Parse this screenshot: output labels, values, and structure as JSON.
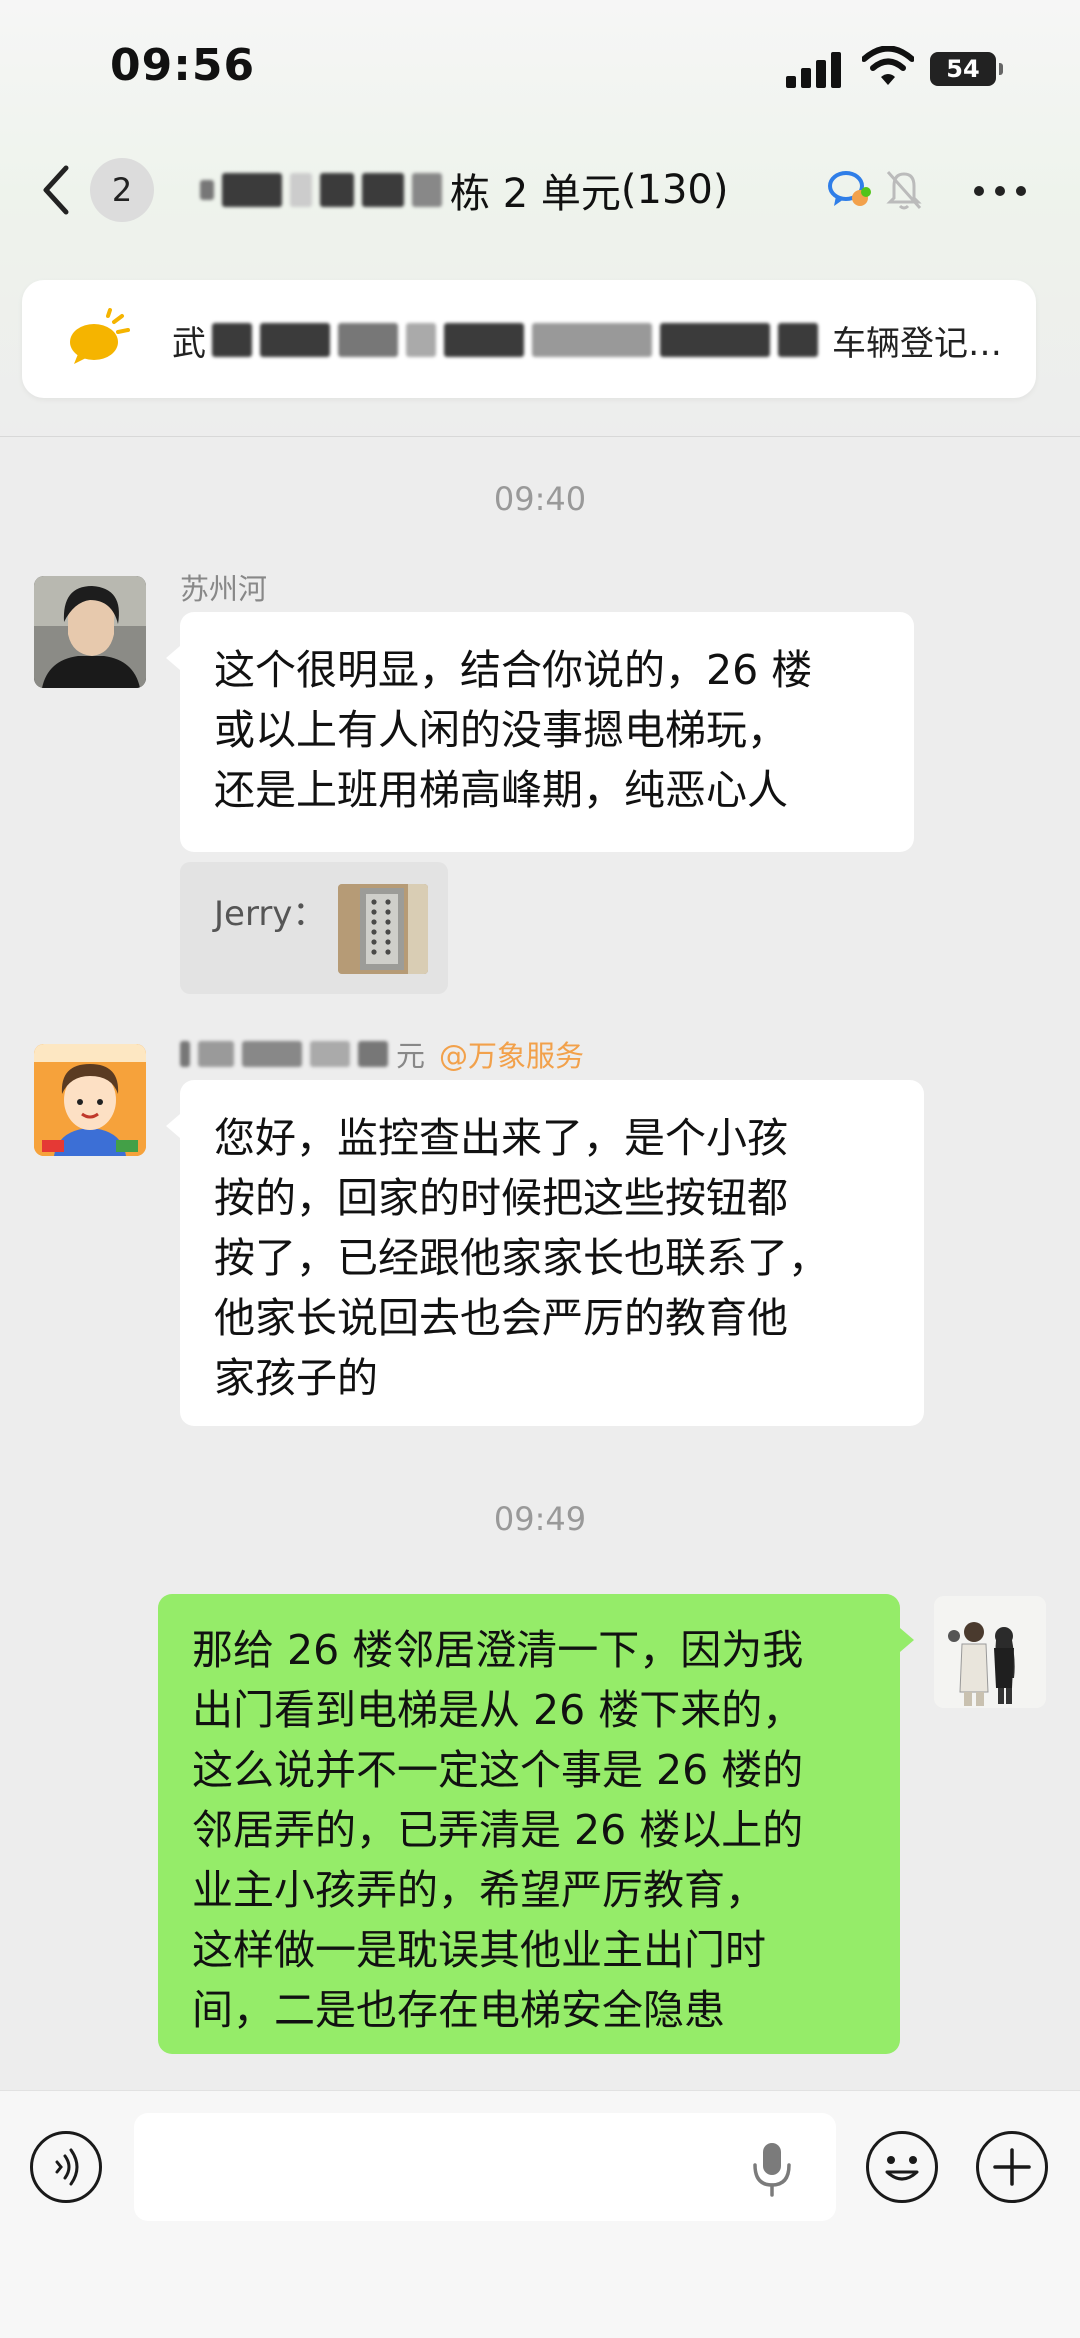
{
  "status_bar": {
    "time": "09:56",
    "battery": "54"
  },
  "nav": {
    "unread_count": "2",
    "title_visible": "栋 2 单元",
    "member_count": "(130)"
  },
  "notice": {
    "text_start": "武",
    "text_end": "车辆登记…"
  },
  "messages": {
    "time1": "09:40",
    "m1_sender": "苏州河",
    "m1_lines": [
      "这个很明显，结合你说的，26 楼",
      "或以上有人闲的没事摁电梯玩，",
      "还是上班用梯高峰期，纯恶心人"
    ],
    "quote_label": "Jerry：",
    "m2_sender_visible": "元",
    "m2_org": "@万象服务",
    "m2_lines": [
      "您好，监控查出来了，是个小孩",
      "按的，回家的时候把这些按钮都",
      "按了，已经跟他家家长也联系了，",
      "他家长说回去也会严厉的教育他",
      "家孩子的"
    ],
    "time2": "09:49",
    "m3_lines": [
      "那给 26 楼邻居澄清一下，因为我",
      "出门看到电梯是从 26 楼下来的，",
      "这么说并不一定这个事是 26 楼的",
      "邻居弄的，已弄清是 26 楼以上的",
      "业主小孩弄的，希望严厉教育，",
      "这样做一是耽误其他业主出门时",
      "间，二是也存在电梯安全隐患"
    ]
  },
  "icons": {
    "voice": "voice-toggle-icon",
    "mic": "mic-icon",
    "emoji": "emoji-icon",
    "plus": "plus-icon"
  },
  "colors": {
    "self_bubble": "#95ec69",
    "other_bubble": "#ffffff",
    "mention": "#f2a14b"
  }
}
